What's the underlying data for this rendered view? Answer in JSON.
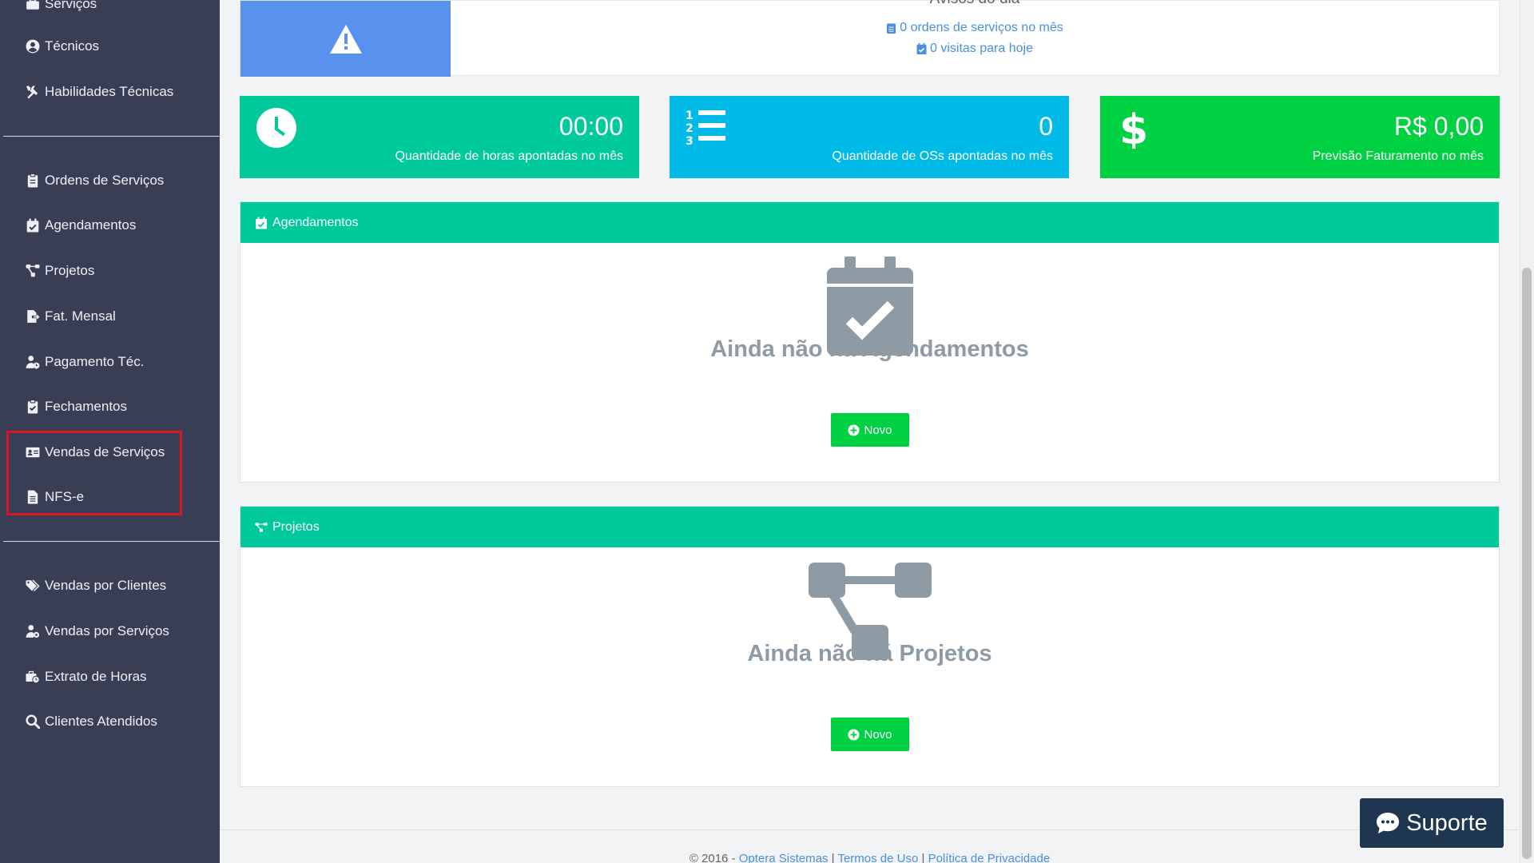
{
  "sidebar": {
    "items": [
      {
        "label": "Serviços",
        "icon": "toolbox-icon"
      },
      {
        "label": "Técnicos",
        "icon": "user-circle-icon"
      },
      {
        "label": "Habilidades Técnicas",
        "icon": "tools-icon"
      },
      {
        "label": "Ordens de Serviços",
        "icon": "clipboard-icon"
      },
      {
        "label": "Agendamentos",
        "icon": "calendar-check-icon"
      },
      {
        "label": "Projetos",
        "icon": "project-diagram-icon"
      },
      {
        "label": "Fat. Mensal",
        "icon": "file-export-icon"
      },
      {
        "label": "Pagamento Téc.",
        "icon": "user-clock-icon"
      },
      {
        "label": "Fechamentos",
        "icon": "clipboard-check-icon"
      },
      {
        "label": "Vendas de Serviços",
        "icon": "id-card-icon"
      },
      {
        "label": "NFS-e",
        "icon": "file-alt-icon"
      },
      {
        "label": "Vendas por Clientes",
        "icon": "tags-icon"
      },
      {
        "label": "Vendas por Serviços",
        "icon": "user-cog-icon"
      },
      {
        "label": "Extrato de Horas",
        "icon": "briefcase-clock-icon"
      },
      {
        "label": "Clientes Atendidos",
        "icon": "search-icon"
      }
    ]
  },
  "notice": {
    "title": "Avisos do dia",
    "orders_text": "0 ordens de serviços no mês",
    "visits_text": "0 visitas para hoje"
  },
  "stats": [
    {
      "value": "00:00",
      "label": "Quantidade de horas apontadas no mês",
      "color": "#00c99b"
    },
    {
      "value": "0",
      "label": "Quantidade de OSs apontadas no mês",
      "color": "#00bbe8"
    },
    {
      "value": "R$ 0,00",
      "label": "Previsão Faturamento no mês",
      "color": "#00d143"
    }
  ],
  "agendamentos": {
    "header": "Agendamentos",
    "empty_text": "Ainda não há Agendamentos",
    "new_label": "Novo"
  },
  "projetos": {
    "header": "Projetos",
    "empty_text": "Ainda não há Projetos",
    "new_label": "Novo"
  },
  "footer": {
    "copyright": "© 2016 -",
    "company_link": "Optera Sistemas",
    "sep": "|",
    "terms_link": "Termos de Uso",
    "privacy_link": "Política de Privacidade"
  },
  "support": {
    "label": "Suporte"
  },
  "colors": {
    "sidebar_bg": "#3a3e55",
    "accent_teal": "#00c99b",
    "accent_cyan": "#00bbe8",
    "accent_green": "#00d143",
    "notice_blue": "#5991ee",
    "highlight_red": "#e0141e",
    "support_bg": "#1f3650"
  }
}
